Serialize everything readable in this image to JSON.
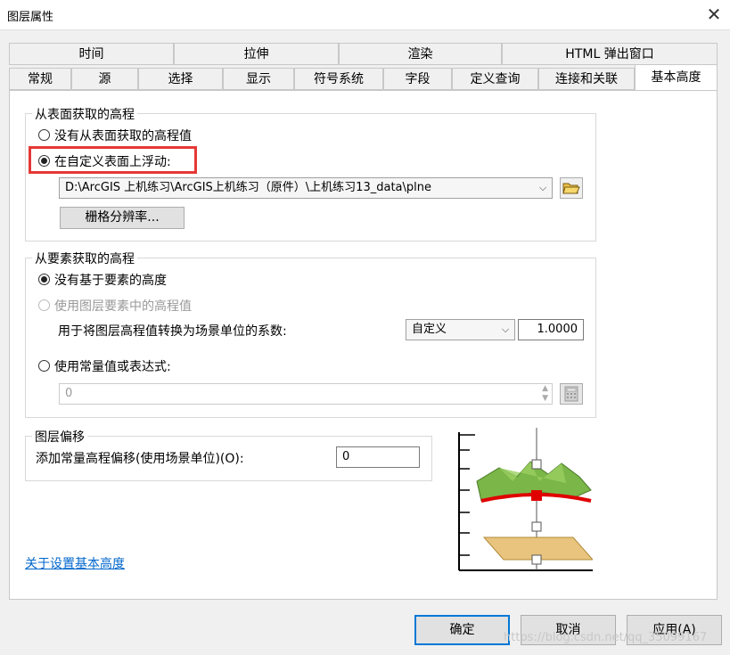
{
  "window": {
    "title": "图层属性",
    "close_glyph": "✕"
  },
  "tabs_row1": [
    "时间",
    "拉伸",
    "渲染",
    "HTML 弹出窗口"
  ],
  "tabs_row2": [
    "常规",
    "源",
    "选择",
    "显示",
    "符号系统",
    "字段",
    "定义查询",
    "连接和关联",
    "基本高度"
  ],
  "active_tab": "基本高度",
  "surface_group": {
    "title": "从表面获取的高程",
    "option_none": "没有从表面获取的高程值",
    "option_custom": "在自定义表面上浮动:",
    "selected": "option_custom",
    "surface_path": "D:\\ArcGIS 上机练习\\ArcGIS上机练习（原件）\\上机练习13_data\\plne",
    "raster_button": "栅格分辨率..."
  },
  "feature_group": {
    "title": "从要素获取的高程",
    "option_none": "没有基于要素的高度",
    "option_layer": "使用图层要素中的高程值",
    "factor_label": "用于将图层高程值转换为场景单位的系数:",
    "factor_unit": "自定义",
    "factor_value": "1.0000",
    "option_expr": "使用常量值或表达式:",
    "expr_value": "0",
    "selected": "option_none"
  },
  "offset_group": {
    "title": "图层偏移",
    "label": "添加常量高程偏移(使用场景单位)(O):",
    "value": "0"
  },
  "help_link": "关于设置基本高度",
  "footer": {
    "ok": "确定",
    "cancel": "取消",
    "apply": "应用(A)"
  },
  "watermark": "https://blog.csdn.net/qq_35099167",
  "colors": {
    "highlight": "#e53935",
    "terrain": "#7ab648",
    "plane": "#e8c47e",
    "marker": "#e00000",
    "link": "#0066cc"
  }
}
